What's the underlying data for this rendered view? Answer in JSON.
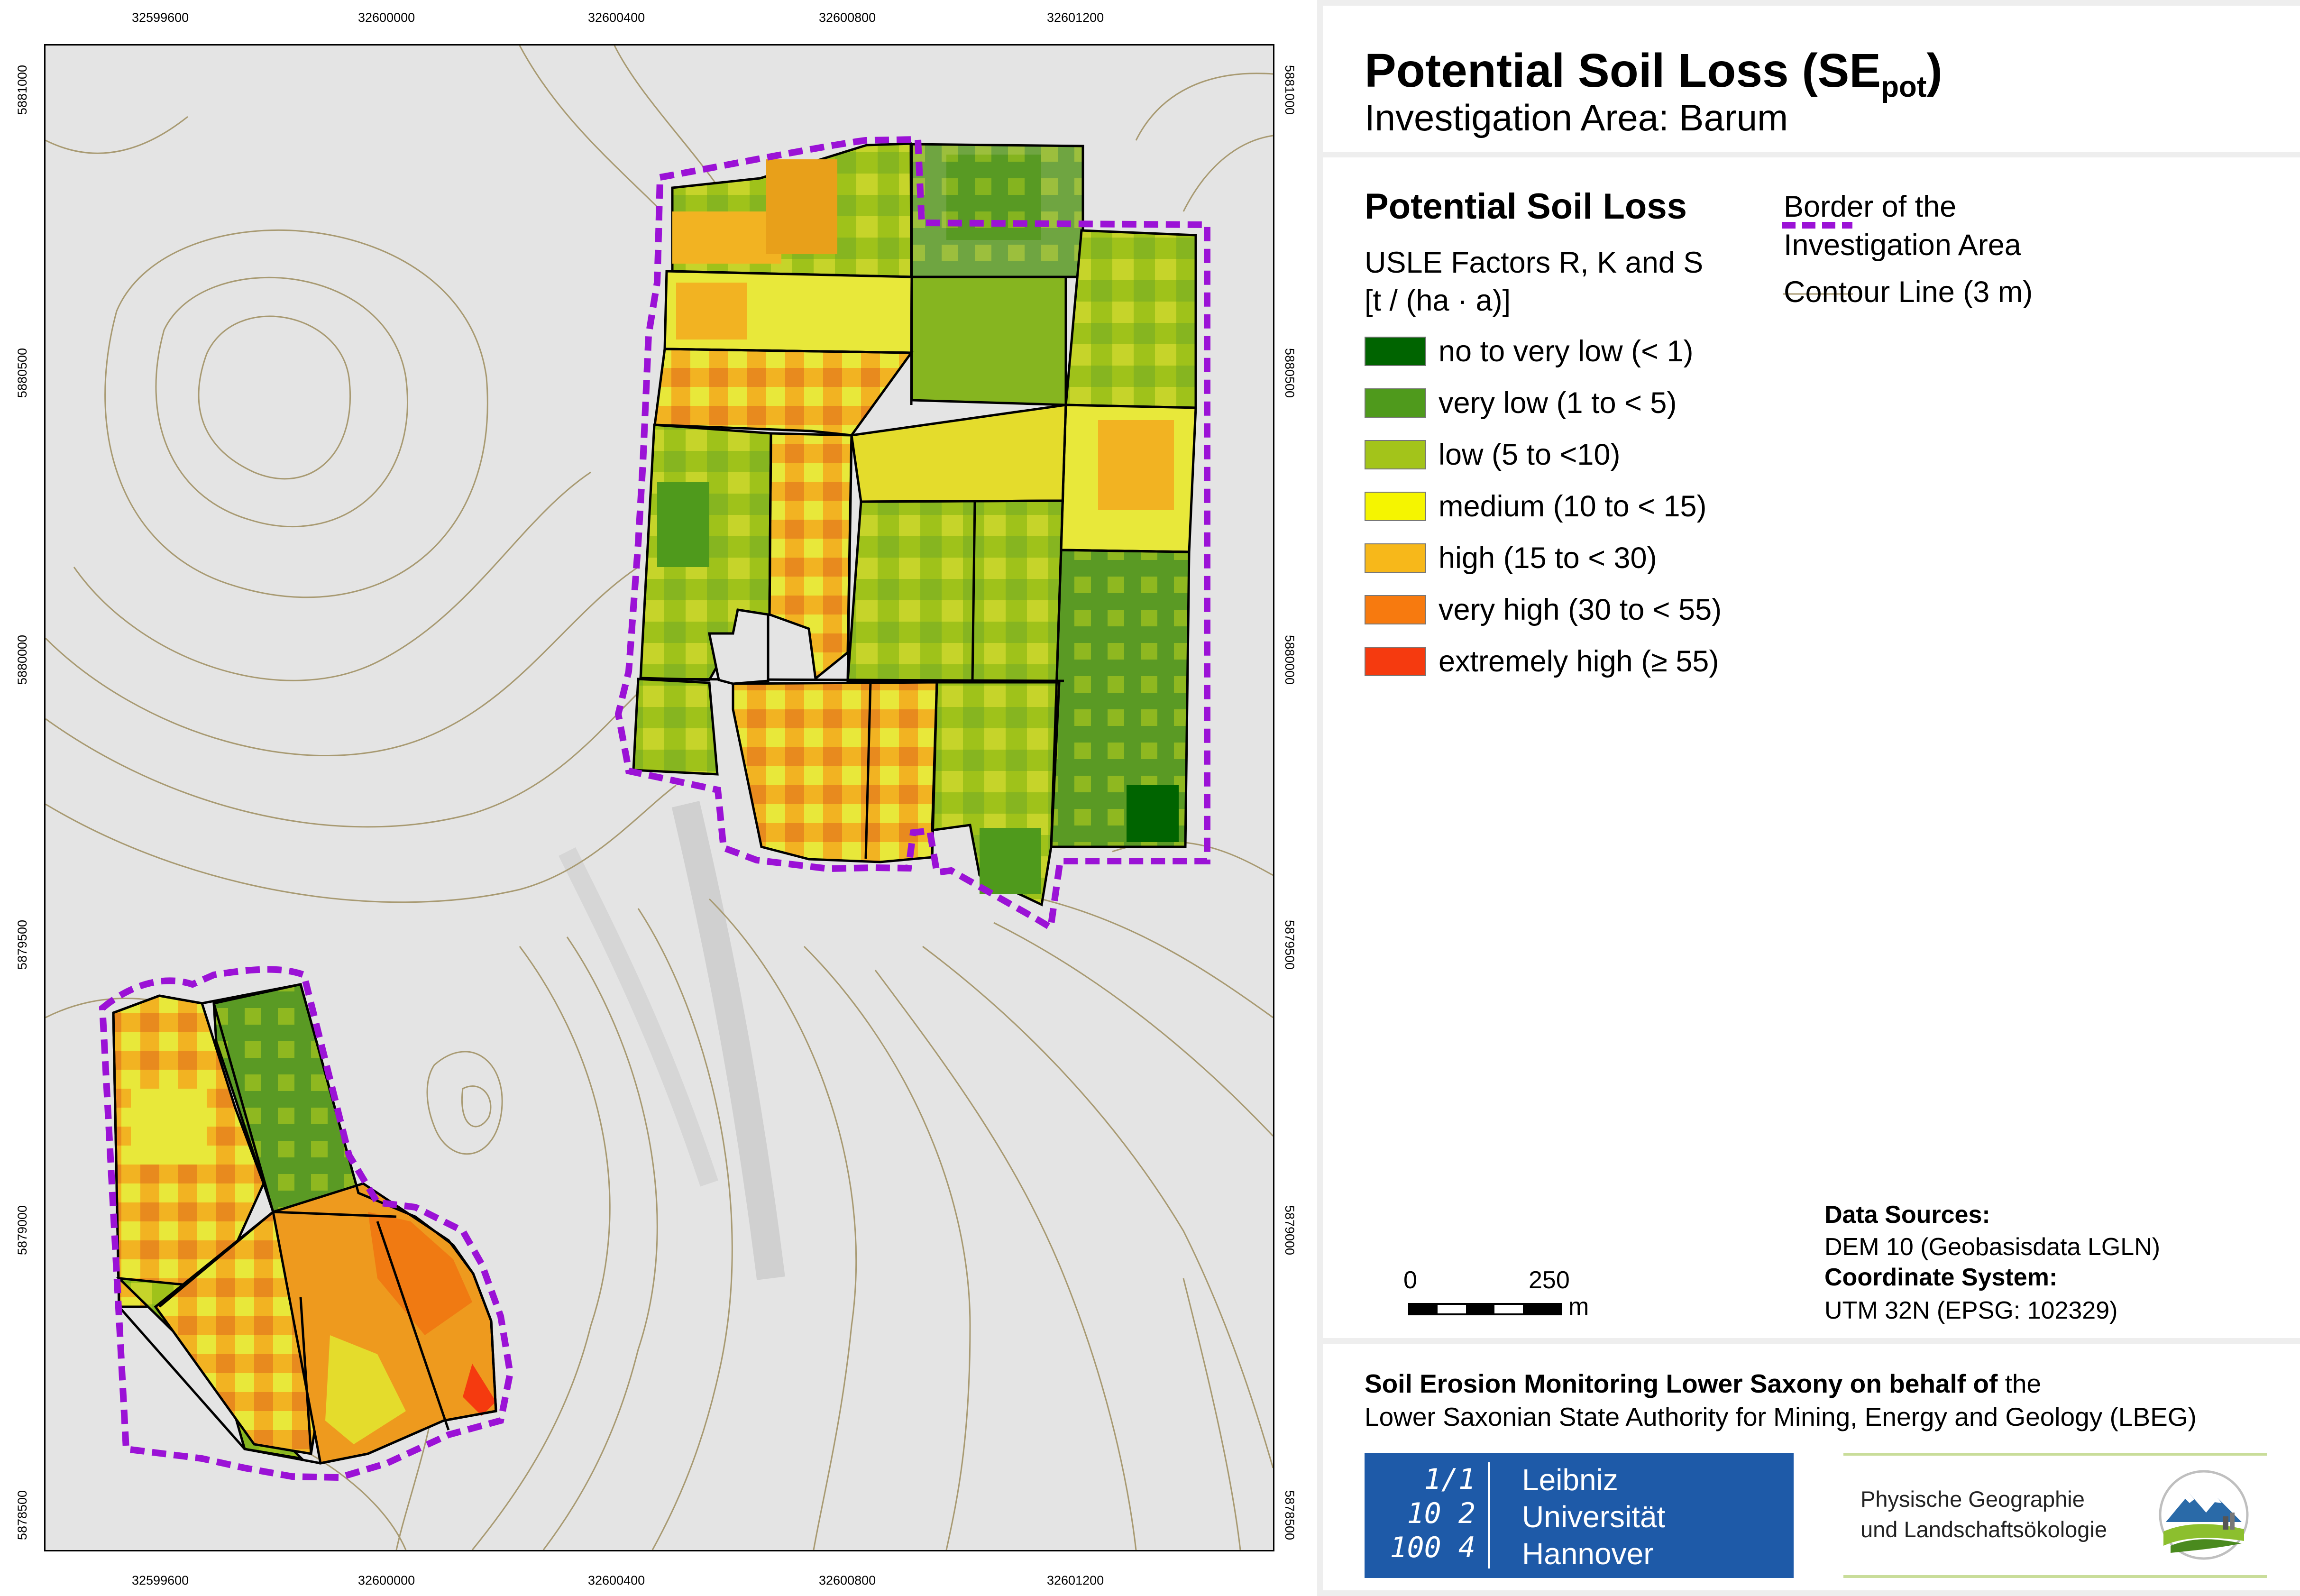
{
  "title": {
    "main": "Potential Soil Loss (SE",
    "sub": "pot",
    "close": ")"
  },
  "subtitle": "Investigation Area: Barum",
  "legend": {
    "heading": "Potential Soil Loss",
    "factors": "USLE Factors R, K and S",
    "unit": "[t / (ha · a)]",
    "classes": [
      {
        "label": "no to very low (< 1)",
        "color": "#006400"
      },
      {
        "label": "very low (1 to < 5)",
        "color": "#4f9a1c"
      },
      {
        "label": "low (5 to <10)",
        "color": "#a3c41a"
      },
      {
        "label": "medium (10 to < 15)",
        "color": "#f5f500"
      },
      {
        "label": "high (15 to < 30)",
        "color": "#f7b81a"
      },
      {
        "label": "very high (30 to < 55)",
        "color": "#f77a0f"
      },
      {
        "label": "extremely high (≥ 55)",
        "color": "#f53a0f"
      }
    ],
    "border_label_1": "Border of the",
    "border_label_2": "Investigation Area",
    "border_color": "#9b12d6",
    "contour_label": "Contour Line (3 m)",
    "contour_color": "#a89a72"
  },
  "scalebar": {
    "zero": "0",
    "value": "250",
    "unit": "m"
  },
  "data_sources": {
    "heading": "Data Sources:",
    "dem": "DEM 10 (Geobasisdata LGLN)",
    "crs_heading": "Coordinate System:",
    "crs": "UTM 32N (EPSG: 102329)"
  },
  "footer": {
    "line1_bold": "Soil Erosion Monitoring Lower Saxony on behalf of",
    "line1_rest": " the",
    "line2": "Lower Saxonian State Authority for Mining, Energy and Geology (LBEG)"
  },
  "logos": {
    "luh_line1": "Leibniz",
    "luh_line2": "Universität",
    "luh_line3": "Hannover",
    "luh_mark_1": "1/1",
    "luh_mark_2": "10 2",
    "luh_mark_3": "100 4",
    "pg_line1": "Physische Geographie",
    "pg_line2": "und Landschaftsökologie"
  },
  "map": {
    "x_ticks": [
      "32599600",
      "32600000",
      "32600400",
      "32600800",
      "32601200"
    ],
    "y_ticks": [
      "5881000",
      "5880500",
      "5880000",
      "5879500",
      "5879000",
      "5878500"
    ]
  }
}
